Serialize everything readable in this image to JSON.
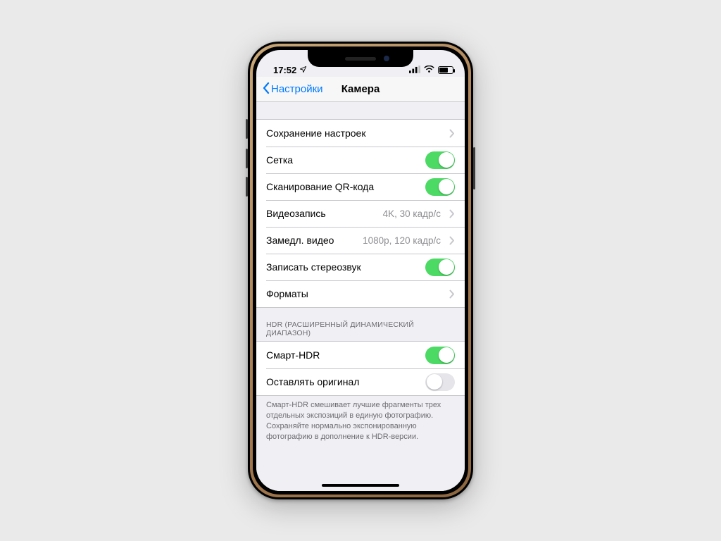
{
  "status": {
    "time": "17:52",
    "location_icon": "location-arrow-icon",
    "signal_icon": "cell-signal-icon",
    "wifi_icon": "wifi-icon",
    "battery_icon": "battery-icon"
  },
  "nav": {
    "back_label": "Настройки",
    "title": "Камера"
  },
  "group1": {
    "items": [
      {
        "label": "Сохранение настроек",
        "type": "disclosure"
      },
      {
        "label": "Сетка",
        "type": "switch",
        "on": true
      },
      {
        "label": "Сканирование QR-кода",
        "type": "switch",
        "on": true
      },
      {
        "label": "Видеозапись",
        "type": "detail",
        "detail": "4K, 30 кадр/с"
      },
      {
        "label": "Замедл. видео",
        "type": "detail",
        "detail": "1080p, 120 кадр/с"
      },
      {
        "label": "Записать стереозвук",
        "type": "switch",
        "on": true
      },
      {
        "label": "Форматы",
        "type": "disclosure"
      }
    ]
  },
  "group2": {
    "header": "HDR (РАСШИРЕННЫЙ ДИНАМИЧЕСКИЙ ДИАПАЗОН)",
    "items": [
      {
        "label": "Смарт-HDR",
        "type": "switch",
        "on": true
      },
      {
        "label": "Оставлять оригинал",
        "type": "switch",
        "on": false
      }
    ],
    "footer": "Смарт-HDR смешивает лучшие фрагменты трех отдельных экспозиций в единую фотографию. Сохраняйте нормально экспонированную фотографию в дополнение к HDR-версии."
  }
}
